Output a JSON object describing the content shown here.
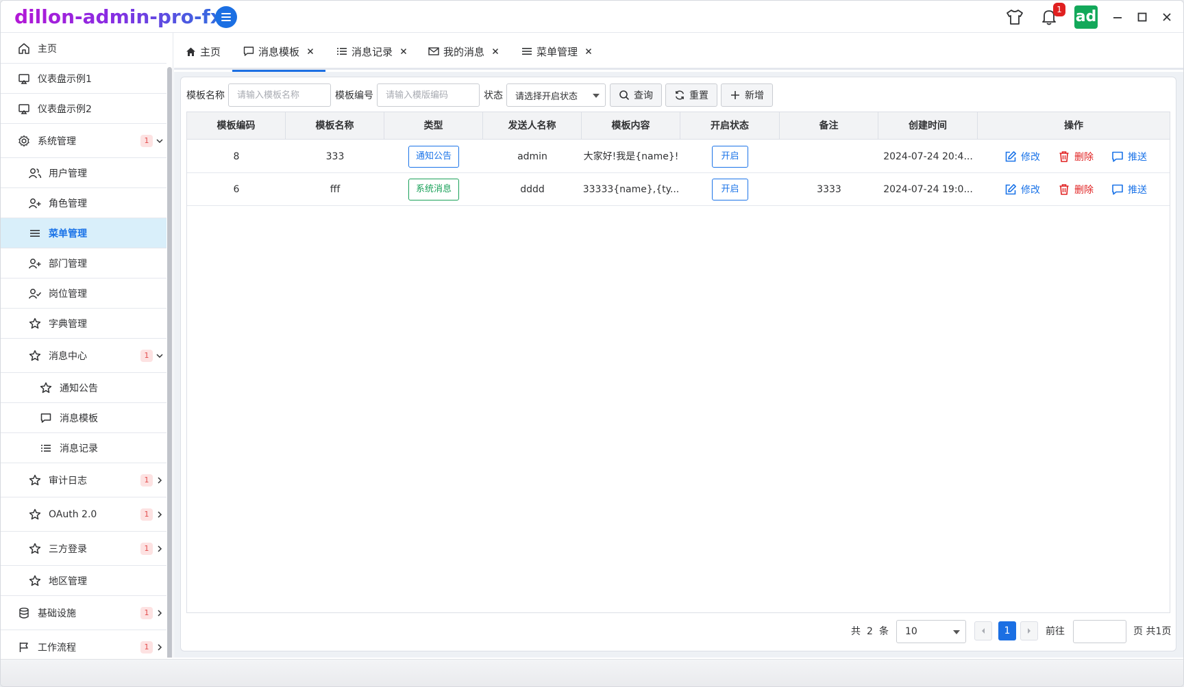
{
  "app": {
    "title": "dillon-admin-pro-fx",
    "avatar_text": "ad",
    "notification_count": "1"
  },
  "sidebar": {
    "items": [
      {
        "label": "主页",
        "icon": "home-icon"
      },
      {
        "label": "仪表盘示例1",
        "icon": "monitor-icon"
      },
      {
        "label": "仪表盘示例2",
        "icon": "monitor-icon"
      },
      {
        "label": "系统管理",
        "icon": "gear-icon",
        "badge": "1",
        "expanded": true
      },
      {
        "label": "用户管理",
        "icon": "users-icon"
      },
      {
        "label": "角色管理",
        "icon": "user-plus-icon"
      },
      {
        "label": "菜单管理",
        "icon": "menu-icon",
        "active": true
      },
      {
        "label": "部门管理",
        "icon": "user-plus-icon"
      },
      {
        "label": "岗位管理",
        "icon": "user-check-icon"
      },
      {
        "label": "字典管理",
        "icon": "star-icon"
      },
      {
        "label": "消息中心",
        "icon": "star-icon",
        "badge": "1",
        "expanded": true
      },
      {
        "label": "通知公告",
        "icon": "star-icon"
      },
      {
        "label": "消息模板",
        "icon": "chat-icon"
      },
      {
        "label": "消息记录",
        "icon": "list-icon"
      },
      {
        "label": "审计日志",
        "icon": "star-icon",
        "badge": "1"
      },
      {
        "label": "OAuth 2.0",
        "icon": "star-icon",
        "badge": "1"
      },
      {
        "label": "三方登录",
        "icon": "star-icon",
        "badge": "1"
      },
      {
        "label": "地区管理",
        "icon": "star-icon"
      },
      {
        "label": "基础设施",
        "icon": "database-icon",
        "badge": "1"
      },
      {
        "label": "工作流程",
        "icon": "flag-icon",
        "badge": "1"
      }
    ]
  },
  "tabs": [
    {
      "label": "主页",
      "icon": "home-icon",
      "closable": false
    },
    {
      "label": "消息模板",
      "icon": "chat-icon",
      "closable": true,
      "active": true
    },
    {
      "label": "消息记录",
      "icon": "list-icon",
      "closable": true
    },
    {
      "label": "我的消息",
      "icon": "mail-icon",
      "closable": true
    },
    {
      "label": "菜单管理",
      "icon": "menu-icon",
      "closable": true
    }
  ],
  "filters": {
    "name_label": "模板名称",
    "name_placeholder": "请输入模板名称",
    "code_label": "模板编号",
    "code_placeholder": "请输入模版编码",
    "status_label": "状态",
    "status_placeholder": "请选择开启状态",
    "query_button": "查询",
    "reset_button": "重置",
    "add_button": "新增"
  },
  "table": {
    "columns": [
      "模板编码",
      "模板名称",
      "类型",
      "发送人名称",
      "模板内容",
      "开启状态",
      "备注",
      "创建时间",
      "操作"
    ],
    "rows": [
      {
        "code": "8",
        "name": "333",
        "type": "通知公告",
        "type_color": "#1a73e8",
        "sender": "admin",
        "content": "大家好!我是{name}!",
        "status": "开启",
        "remark": "",
        "created": "2024-07-24 20:4..."
      },
      {
        "code": "6",
        "name": "fff",
        "type": "系统消息",
        "type_color": "#18a058",
        "sender": "dddd",
        "content": "33333{name},{ty...",
        "status": "开启",
        "remark": "3333",
        "created": "2024-07-24 19:0..."
      }
    ],
    "actions": {
      "edit": "修改",
      "delete": "删除",
      "push": "推送"
    }
  },
  "pagination": {
    "total_prefix": "共",
    "total": "2",
    "total_suffix": "条",
    "page_size": "10",
    "current_page": "1",
    "goto_label": "前往",
    "page_suffix": "页 共1页"
  },
  "colors": {
    "accent": "#1b6fe3",
    "danger": "#e02020",
    "success": "#18a058",
    "active_bg": "#d9effa"
  }
}
